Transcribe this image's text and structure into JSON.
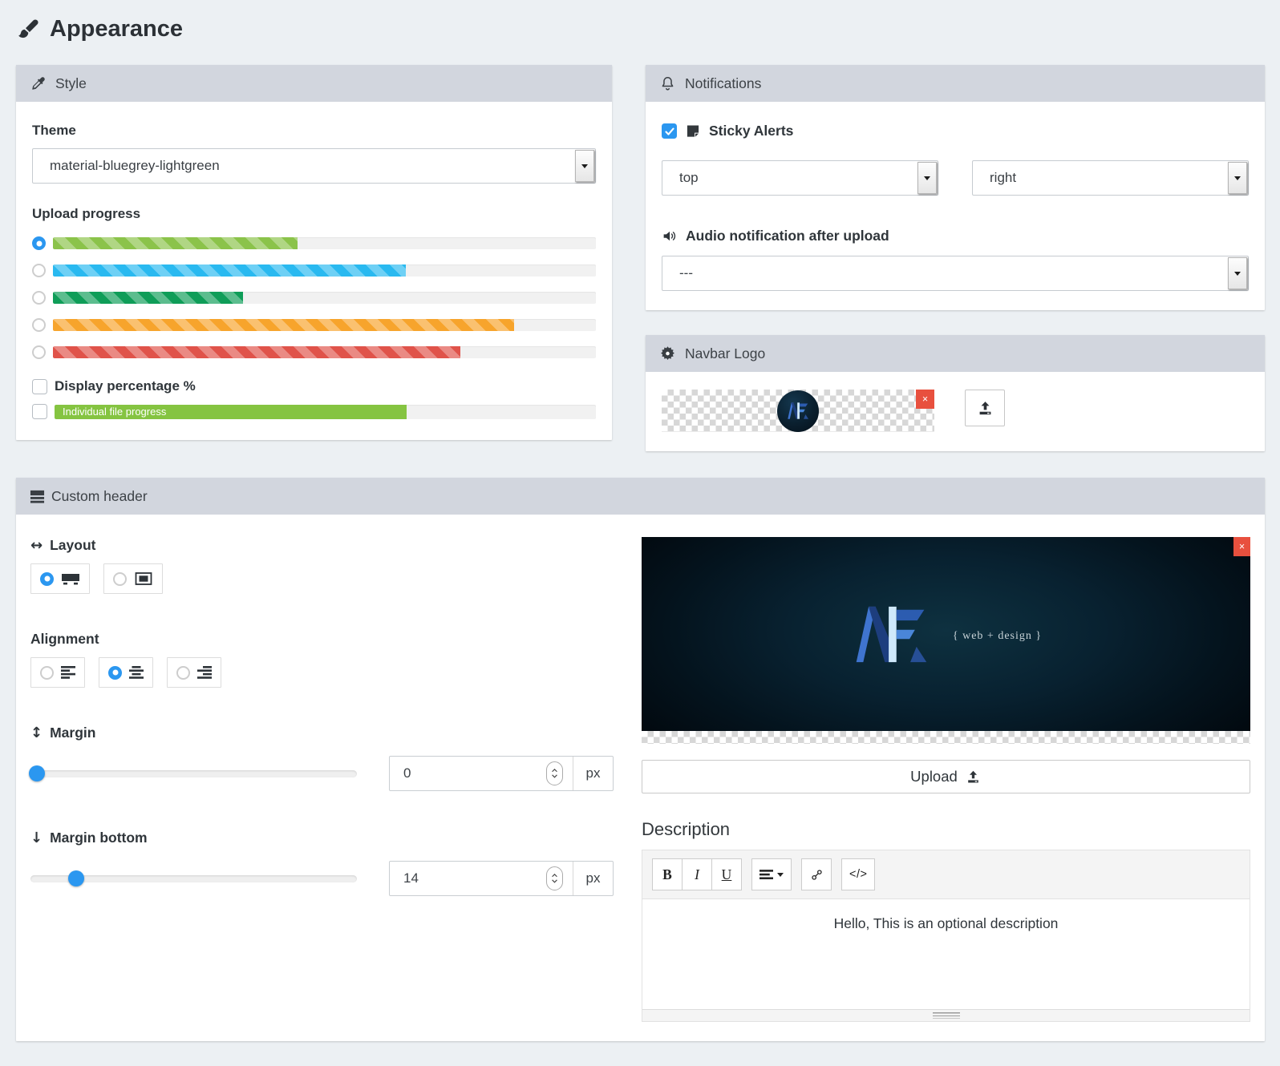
{
  "icons": {
    "close": "×",
    "arrow_leftright": "↔",
    "arrow_updown": "↕",
    "arrow_down": "↓",
    "code": "</>"
  },
  "page": {
    "title": "Appearance"
  },
  "style_panel": {
    "title": "Style",
    "theme_label": "Theme",
    "theme_value": "material-bluegrey-lightgreen",
    "upload_progress_label": "Upload progress",
    "progress_options": [
      {
        "name": "lightgreen",
        "color": "#8bc34a",
        "width": "45%",
        "selected": true
      },
      {
        "name": "lightblue",
        "color": "#29b9f0",
        "width": "65%",
        "selected": false
      },
      {
        "name": "green",
        "color": "#0f9d58",
        "width": "35%",
        "selected": false
      },
      {
        "name": "orange",
        "color": "#f7a42c",
        "width": "85%",
        "selected": false
      },
      {
        "name": "red",
        "color": "#e0534a",
        "width": "75%",
        "selected": false
      }
    ],
    "display_percentage_label": "Display percentage %",
    "display_percentage_checked": false,
    "individual_progress_label": "Individual file progress",
    "individual_progress_width": "65%",
    "individual_progress_color": "#85c441",
    "individual_progress_checked": false
  },
  "notifications_panel": {
    "title": "Notifications",
    "sticky_alerts_label": "Sticky Alerts",
    "sticky_alerts_checked": true,
    "vertical_position_value": "top",
    "horizontal_position_value": "right",
    "audio_label": "Audio notification after upload",
    "audio_value": "---"
  },
  "navbar_logo_panel": {
    "title": "Navbar Logo"
  },
  "custom_header_panel": {
    "title": "Custom header",
    "layout_label": "Layout",
    "alignment_label": "Alignment",
    "margin": {
      "label": "Margin",
      "value": "0",
      "unit": "px",
      "thumb_left": "2%"
    },
    "margin_bottom": {
      "label": "Margin bottom",
      "value": "14",
      "unit": "px",
      "thumb_left": "14%"
    },
    "preview": {
      "tagline": "{ web + design }"
    },
    "upload_label": "Upload",
    "description_label": "Description",
    "toolbar": {
      "bold": "B",
      "italic": "I",
      "underline": "U"
    },
    "description_text": "Hello, This is an optional description"
  }
}
